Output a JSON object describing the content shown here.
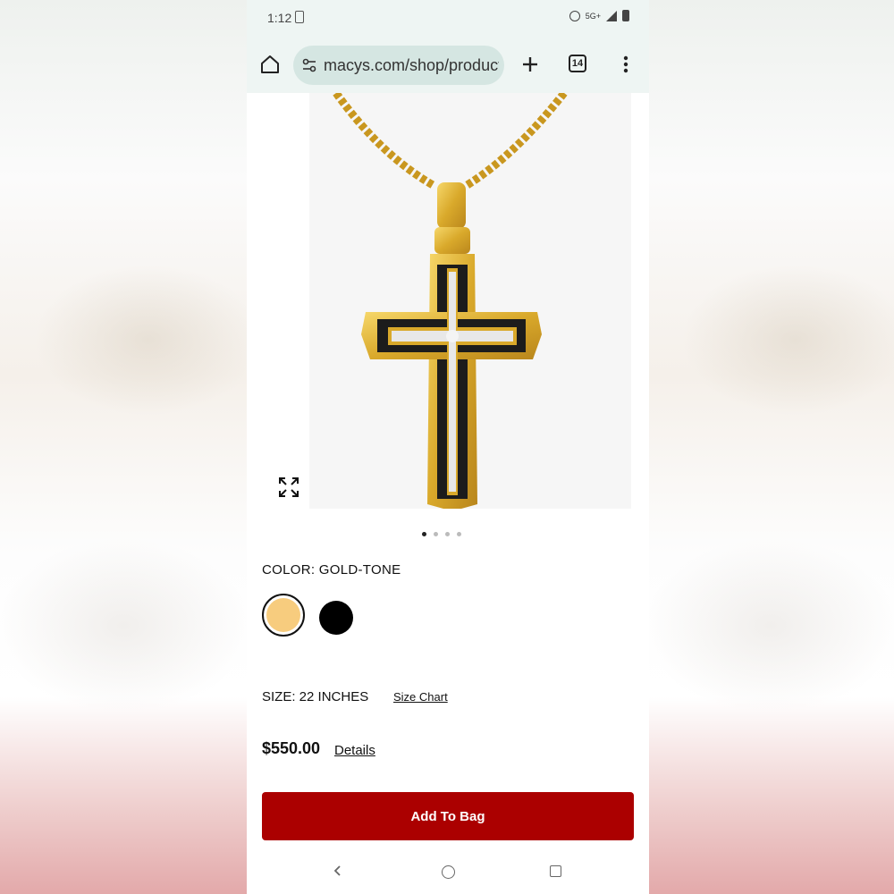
{
  "status_bar": {
    "time": "1:12",
    "network": "5G+"
  },
  "browser": {
    "url": "macys.com/shop/product",
    "tab_count": "14"
  },
  "product": {
    "image_alt": "Gold-tone cross pendant necklace",
    "carousel": {
      "total": 4,
      "active": 1
    },
    "color_label": "COLOR: GOLD-TONE",
    "swatches": [
      {
        "name": "gold-tone",
        "color": "#f7cc7e",
        "selected": true
      },
      {
        "name": "black",
        "color": "#000000",
        "selected": false
      }
    ],
    "size_label": "SIZE: 22 INCHES",
    "size_chart_label": "Size Chart",
    "price": "$550.00",
    "details_label": "Details",
    "add_to_bag_label": "Add To Bag"
  },
  "colors": {
    "accent": "#ab0000",
    "toolbar": "#eef5f3",
    "url_pill": "#d5e6e2"
  }
}
